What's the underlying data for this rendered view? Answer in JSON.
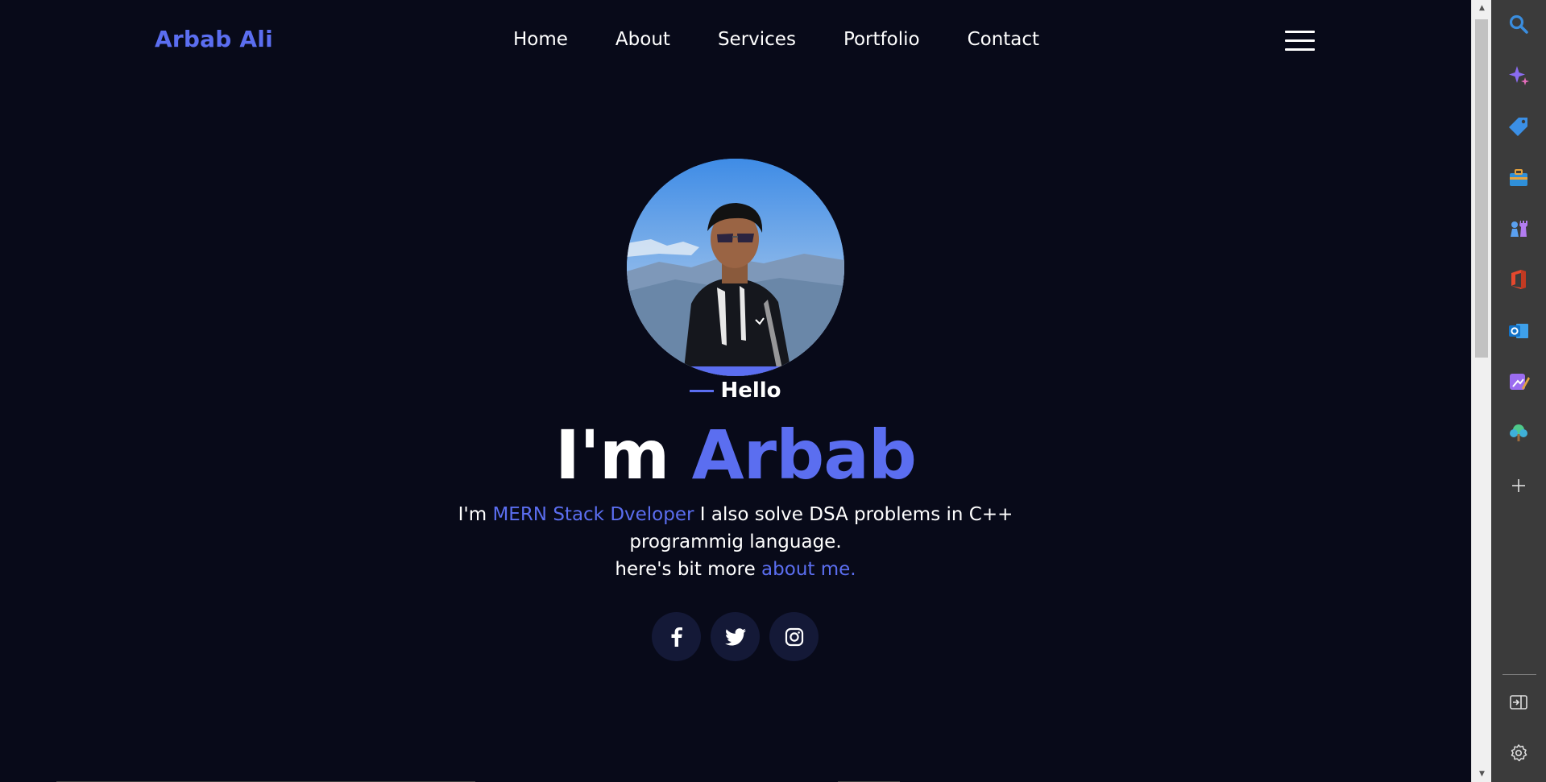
{
  "nav": {
    "logo": "Arbab Ali",
    "links": [
      "Home",
      "About",
      "Services",
      "Portfolio",
      "Contact"
    ],
    "menu_icon": "hamburger-icon"
  },
  "hero": {
    "greeting": "Hello",
    "headline_prefix": "I'm",
    "headline_name": "Arbab",
    "desc_prefix": "I'm",
    "desc_role": "MERN Stack Dveloper",
    "desc_rest": "I also solve DSA problems in C++ programmig language.",
    "desc_line2_prefix": "here's bit more",
    "desc_link": "about me.",
    "socials": [
      "facebook-icon",
      "twitter-icon",
      "instagram-icon"
    ],
    "avatar": "profile-photo"
  },
  "sidebar": {
    "icons": [
      "search-icon",
      "sparkle-icon",
      "tag-icon",
      "briefcase-icon",
      "chess-icon",
      "office-icon",
      "outlook-icon",
      "designer-icon",
      "tree-icon",
      "add-icon",
      "exit-panel-icon",
      "settings-icon"
    ]
  },
  "colors": {
    "background": "#080a19",
    "accent": "#5b6ef0",
    "social_bg": "#141937"
  }
}
